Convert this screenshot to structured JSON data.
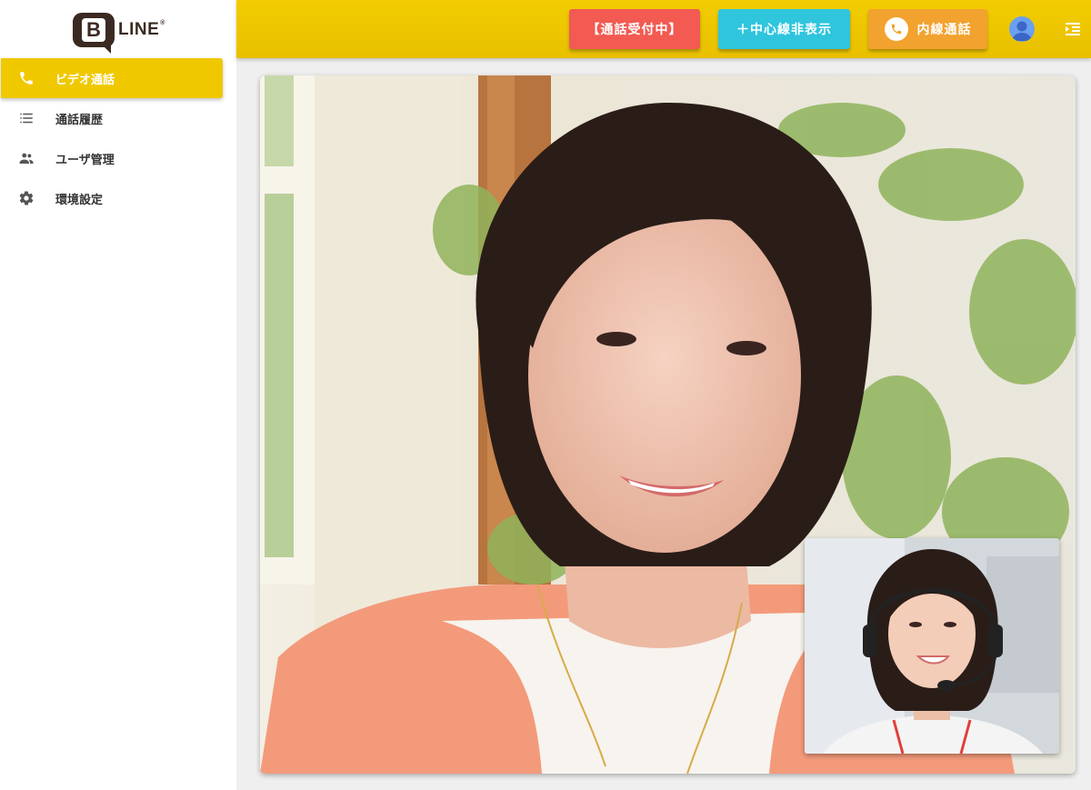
{
  "brand": {
    "logo_letter": "B",
    "logo_text": "LINE",
    "logo_mark": "®"
  },
  "sidebar": {
    "items": [
      {
        "label": "ビデオ通話",
        "icon": "phone-icon",
        "active": true
      },
      {
        "label": "通話履歴",
        "icon": "list-icon",
        "active": false
      },
      {
        "label": "ユーザ管理",
        "icon": "people-icon",
        "active": false
      },
      {
        "label": "環境設定",
        "icon": "gear-icon",
        "active": false
      }
    ]
  },
  "header": {
    "accept_label": "【通話受付中】",
    "center_line_label": "＋中心線非表示",
    "internal_call_label": "内線通話"
  },
  "colors": {
    "accent_yellow": "#f0c800",
    "accept_red": "#f25a52",
    "center_cyan": "#2ec5dd",
    "internal_orange": "#f2a22e",
    "brand_brown": "#3b2a22"
  }
}
